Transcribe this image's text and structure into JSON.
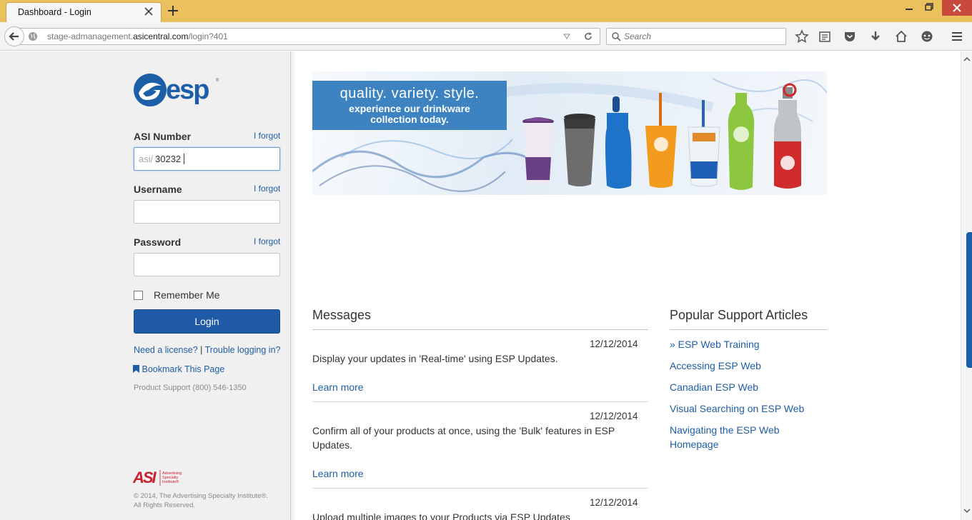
{
  "browser": {
    "tab_title": "Dashboard - Login",
    "url_prefix": "stage-admanagement.",
    "url_domain": "asicentral.com",
    "url_path": "/login?401",
    "search_placeholder": "Search"
  },
  "login": {
    "asi_label": "ASI Number",
    "asi_prefix": "asi/",
    "asi_value": "30232",
    "username_label": "Username",
    "password_label": "Password",
    "forgot_label": "I forgot",
    "remember_label": "Remember Me",
    "login_button": "Login",
    "need_license": "Need a license?",
    "separator": " | ",
    "trouble": "Trouble logging in?",
    "bookmark": "Bookmark This Page",
    "support": "Product Support (800) 546-1350",
    "asi_logo_text": "Advertising Specialty Institute",
    "copyright_1": "© 2014, The Advertising Specialty Institute®.",
    "copyright_2": "All Rights Reserved."
  },
  "banner": {
    "line1": "quality. variety. style.",
    "line2": "experience our drinkware",
    "line3": "collection today."
  },
  "messages": {
    "title": "Messages",
    "items": [
      {
        "date": "12/12/2014",
        "text": "Display your updates in 'Real-time' using ESP Updates.",
        "link": "Learn more"
      },
      {
        "date": "12/12/2014",
        "text": "Confirm all of your products at once, using the 'Bulk' features in ESP Updates.",
        "link": "Learn more"
      },
      {
        "date": "12/12/2014",
        "text": "Upload multiple images to your Products via ESP Updates"
      }
    ]
  },
  "support_articles": {
    "title": "Popular Support Articles",
    "items": [
      "» ESP Web Training",
      "Accessing ESP Web",
      "Canadian ESP Web",
      "Visual Searching on ESP Web",
      "Navigating the ESP Web Homepage"
    ]
  }
}
